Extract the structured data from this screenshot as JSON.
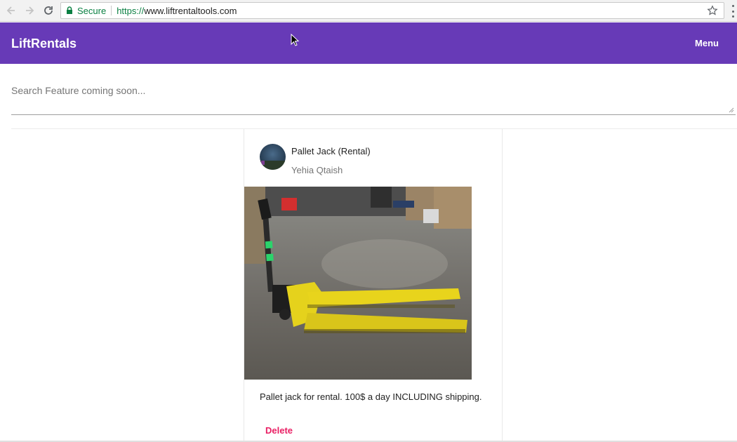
{
  "browser": {
    "secure_label": "Secure",
    "url_scheme": "https://",
    "url_host": "www.liftrentaltools.com",
    "icons": {
      "back": "arrow-left-icon",
      "forward": "arrow-right-icon",
      "reload": "reload-icon",
      "lock": "lock-icon",
      "bookmark": "star-icon",
      "more": "kebab-menu-icon"
    },
    "colors": {
      "secure": "#0b8043"
    }
  },
  "app": {
    "brand": "LiftRentals",
    "menu_label": "Menu",
    "colors": {
      "primary": "#673ab7",
      "delete": "#e91e63"
    }
  },
  "search": {
    "placeholder": "Search Feature coming soon..."
  },
  "post": {
    "title": "Pallet Jack (Rental)",
    "author": "Yehia Qtaish",
    "description": "Pallet jack for rental. 100$ a day INCLUDING shipping.",
    "delete_label": "Delete"
  }
}
